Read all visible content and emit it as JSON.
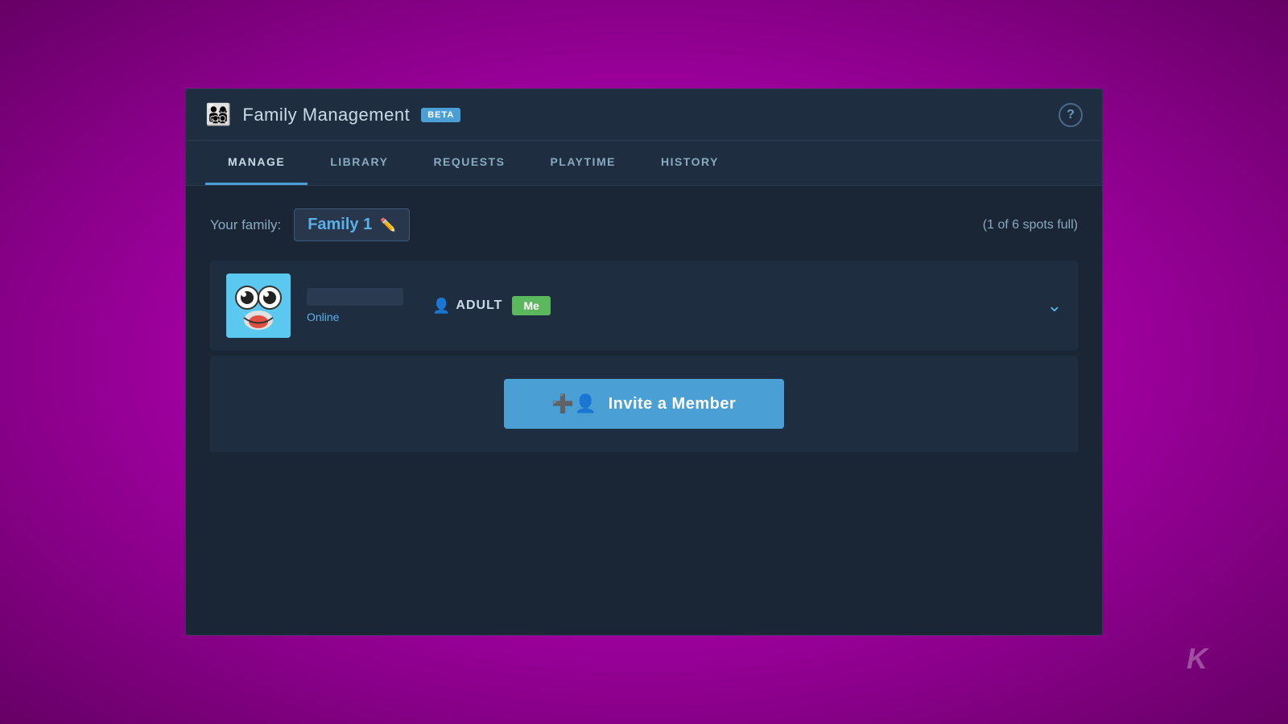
{
  "window": {
    "title": "Family Management",
    "beta_badge": "BETA"
  },
  "tabs": [
    {
      "id": "manage",
      "label": "MANAGE",
      "active": true
    },
    {
      "id": "library",
      "label": "LIBRARY",
      "active": false
    },
    {
      "id": "requests",
      "label": "REQUESTS",
      "active": false
    },
    {
      "id": "playtime",
      "label": "PLAYTIME",
      "active": false
    },
    {
      "id": "history",
      "label": "HISTORY",
      "active": false
    }
  ],
  "family": {
    "label": "Your family:",
    "name": "Family 1",
    "spots": "(1 of 6 spots full)"
  },
  "member": {
    "status": "Online",
    "role": "ADULT",
    "me_badge": "Me"
  },
  "invite": {
    "label": "Invite a Member"
  },
  "watermark": "K"
}
